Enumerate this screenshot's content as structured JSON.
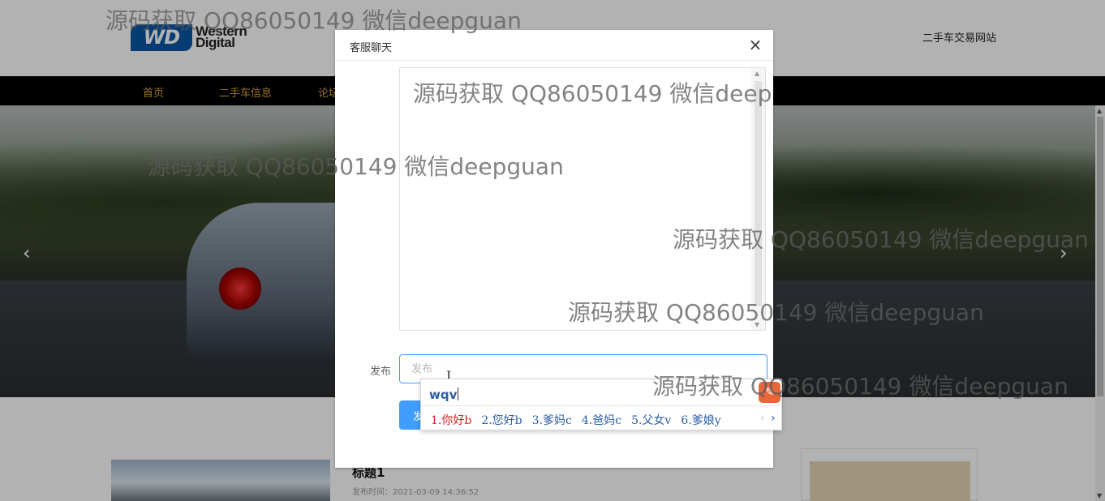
{
  "header": {
    "logo": {
      "line1": "Western",
      "line2": "Digital",
      "badge": "WD"
    },
    "site_title": "二手车交易网站"
  },
  "nav": {
    "items": [
      {
        "label": "首页"
      },
      {
        "label": "二手车信息"
      },
      {
        "label": "论坛"
      }
    ]
  },
  "hero": {
    "prev_icon": "chevron-left-icon",
    "next_icon": "chevron-right-icon",
    "prev_glyph": "‹",
    "next_glyph": "›"
  },
  "article": {
    "title": "标题1",
    "time": "发布时间：2021-03-09 14:36:52"
  },
  "dialog": {
    "title": "客服聊天",
    "close_glyph": "×",
    "publish_label": "发布",
    "publish_placeholder": "发布",
    "submit_label": "发布"
  },
  "ime": {
    "input": "wqv",
    "candidates": [
      {
        "label": "1.你好b",
        "active": true
      },
      {
        "label": "2.您好b",
        "active": false
      },
      {
        "label": "3.爹妈c",
        "active": false
      },
      {
        "label": "4.爸妈c",
        "active": false
      },
      {
        "label": "5.父女v",
        "active": false
      },
      {
        "label": "6.爹娘y",
        "active": false
      }
    ],
    "prev_glyph": "‹",
    "next_glyph": "›",
    "logo_glyph": "✎"
  },
  "watermark": "源码获取 QQ86050149 微信deepguan",
  "colors": {
    "accent": "#409eff",
    "nav_bg": "#000000",
    "nav_text": "#d8a43a",
    "ime_active": "#d02020",
    "ime_text": "#2b5ea8"
  }
}
